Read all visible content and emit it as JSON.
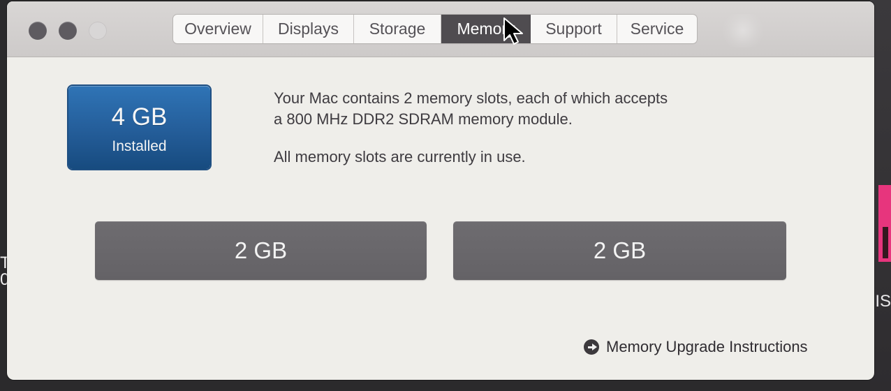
{
  "window": {
    "tabs": [
      {
        "label": "Overview"
      },
      {
        "label": "Displays"
      },
      {
        "label": "Storage"
      },
      {
        "label": "Memory",
        "selected": true
      },
      {
        "label": "Support"
      },
      {
        "label": "Service"
      }
    ]
  },
  "memory": {
    "installed_size": "4 GB",
    "installed_label": "Installed",
    "description_line_1": "Your Mac contains 2 memory slots, each of which accepts",
    "description_line_2": "a 800 MHz DDR2 SDRAM memory module.",
    "status": "All memory slots are currently in use.",
    "slots": [
      {
        "size": "2 GB"
      },
      {
        "size": "2 GB"
      }
    ],
    "upgrade_link": "Memory Upgrade Instructions"
  },
  "theme": {
    "selected_tab": "#4f4c50",
    "installed_blue": "#245d99",
    "slot_gray": "#6a686c",
    "background": "#efeeea"
  },
  "icons": {
    "traffic_lights": [
      "close-icon",
      "minimize-icon",
      "zoom-icon"
    ],
    "cursor": "pointer-cursor-icon",
    "upgrade": "right-arrow-circle-icon"
  },
  "background_fragments": {
    "left": "T\n0",
    "right": "IS"
  }
}
